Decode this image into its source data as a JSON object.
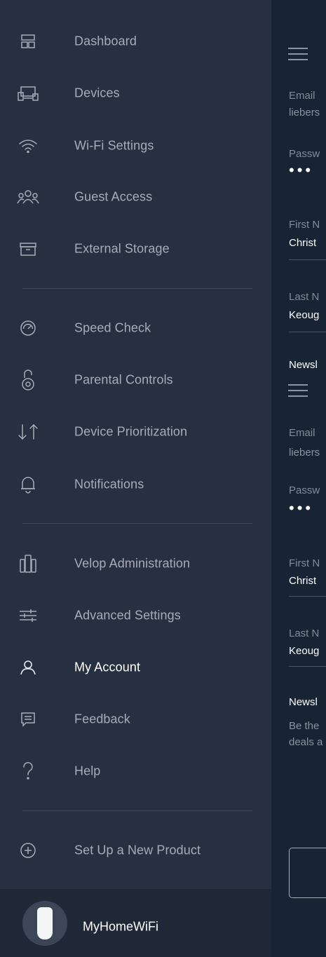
{
  "sidebar": {
    "items": [
      {
        "label": "Dashboard",
        "icon": "dashboard-icon"
      },
      {
        "label": "Devices",
        "icon": "devices-icon"
      },
      {
        "label": "Wi-Fi Settings",
        "icon": "wifi-icon"
      },
      {
        "label": "Guest Access",
        "icon": "guest-access-icon"
      },
      {
        "label": "External Storage",
        "icon": "external-storage-icon"
      },
      {
        "label": "Speed Check",
        "icon": "speedometer-icon"
      },
      {
        "label": "Parental Controls",
        "icon": "parental-lock-icon"
      },
      {
        "label": "Device Prioritization",
        "icon": "prioritization-arrows-icon"
      },
      {
        "label": "Notifications",
        "icon": "bell-icon"
      },
      {
        "label": "Velop Administration",
        "icon": "velop-nodes-icon"
      },
      {
        "label": "Advanced Settings",
        "icon": "sliders-icon"
      },
      {
        "label": "My Account",
        "icon": "user-icon",
        "active": true
      },
      {
        "label": "Feedback",
        "icon": "feedback-icon"
      },
      {
        "label": "Help",
        "icon": "help-icon"
      },
      {
        "label": "Set Up a New Product",
        "icon": "plus-circle-icon"
      }
    ]
  },
  "footer": {
    "network_name": "MyHomeWiFi",
    "icon": "velop-node-icon"
  },
  "right_panel": {
    "top": {
      "email_label": "Email",
      "email_value": "liebers",
      "password_label": "Passw",
      "password_value": "•••",
      "first_name_label": "First N",
      "first_name_value": "Christ",
      "last_name_label": "Last N",
      "last_name_value": "Keoug",
      "newsletter_label": "Newsl"
    },
    "bottom": {
      "email_label": "Email",
      "email_value": "liebers",
      "password_label": "Passw",
      "password_value": "•••",
      "first_name_label": "First N",
      "first_name_value": "Christ",
      "last_name_label": "Last N",
      "last_name_value": "Keoug",
      "newsletter_label": "Newsl",
      "newsletter_desc_line1": "Be the",
      "newsletter_desc_line2": "deals a"
    }
  },
  "colors": {
    "sidebar_bg": "#273040",
    "panel_bg": "#182434",
    "text_muted": "#a7adb6",
    "text_active": "#ffffff"
  }
}
